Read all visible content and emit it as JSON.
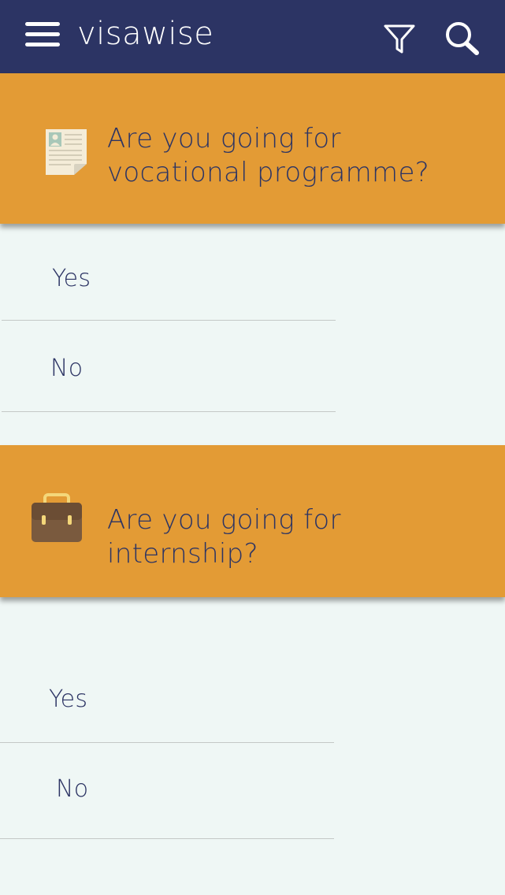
{
  "app": {
    "title": "visawise"
  },
  "toolbar": {
    "menu_icon": "hamburger-menu",
    "filter_icon": "funnel-filter",
    "search_icon": "magnifier-search"
  },
  "questions": [
    {
      "icon": "document-id-icon",
      "text": "Are you going for vocational programme?",
      "options": [
        "Yes",
        "No"
      ]
    },
    {
      "icon": "briefcase-icon",
      "text": "Are you going for internship?",
      "options": [
        "Yes",
        "No"
      ]
    }
  ],
  "colors": {
    "appbar": "#2c3464",
    "question_bg": "#e39b35",
    "page_bg": "#eff7f5",
    "text": "#2c3464"
  }
}
